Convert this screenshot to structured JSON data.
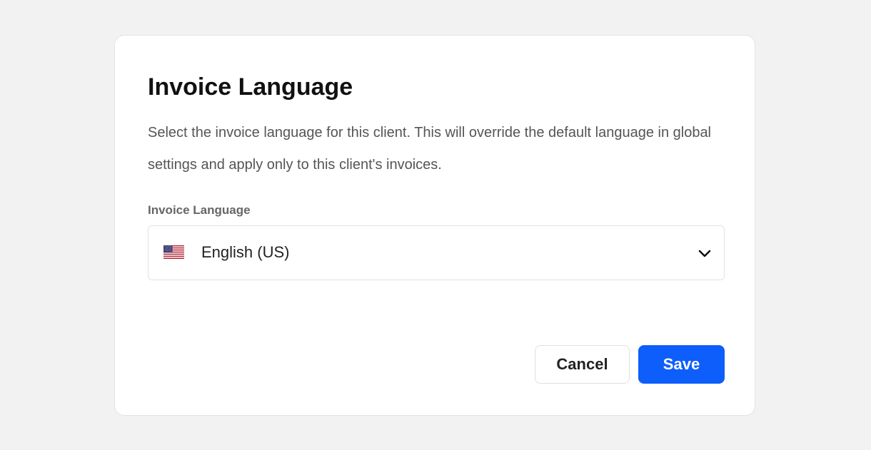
{
  "dialog": {
    "title": "Invoice Language",
    "description": "Select the invoice language for this client. This will override the default language in global settings and apply only to this client's invoices.",
    "field_label": "Invoice Language",
    "select": {
      "value": "English (US)",
      "flag_icon": "us-flag-icon",
      "dropdown_icon": "chevron-down-icon"
    },
    "buttons": {
      "cancel_label": "Cancel",
      "save_label": "Save"
    }
  },
  "colors": {
    "page_background": "#f2f2f2",
    "primary": "#0d5efb",
    "title_text": "#111111",
    "body_text": "#555555",
    "label_text": "#666666"
  }
}
